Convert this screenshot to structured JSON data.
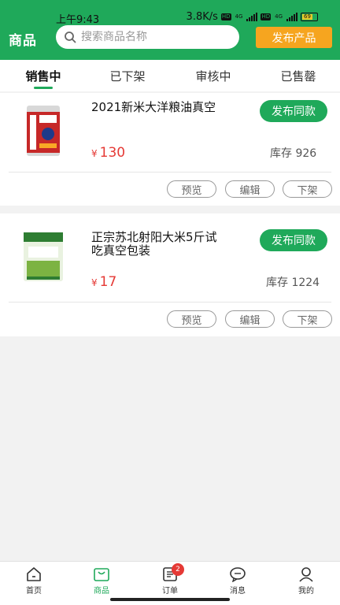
{
  "status_bar": {
    "time": "上午9:43",
    "speed": "3.8K/s",
    "hd1": "HD",
    "net1": "4G",
    "hd2": "HD",
    "net2": "4G",
    "battery": "69"
  },
  "header": {
    "title": "商品",
    "search_placeholder": "搜索商品名称",
    "publish_label": "发布产品"
  },
  "tabs": [
    {
      "label": "销售中",
      "active": true
    },
    {
      "label": "已下架",
      "active": false
    },
    {
      "label": "审核中",
      "active": false
    },
    {
      "label": "已售罄",
      "active": false
    }
  ],
  "products": [
    {
      "name": "2021新米大洋粮油真空",
      "currency": "¥",
      "price": "130",
      "stock": "库存 926",
      "publish_same": "发布同款",
      "actions": {
        "preview": "预览",
        "edit": "编辑",
        "off_shelf": "下架"
      }
    },
    {
      "name": "正宗苏北射阳大米5斤试吃真空包装",
      "currency": "¥",
      "price": "17",
      "stock": "库存 1224",
      "publish_same": "发布同款",
      "actions": {
        "preview": "预览",
        "edit": "编辑",
        "off_shelf": "下架"
      }
    }
  ],
  "bottom_nav": [
    {
      "label": "首页",
      "icon": "home-icon"
    },
    {
      "label": "商品",
      "icon": "bag-icon",
      "active": true
    },
    {
      "label": "订单",
      "icon": "order-icon",
      "badge": "2"
    },
    {
      "label": "消息",
      "icon": "message-icon"
    },
    {
      "label": "我的",
      "icon": "user-icon"
    }
  ],
  "colors": {
    "brand": "#1fa95a",
    "accent": "#f6a51f",
    "price": "#e53935"
  }
}
